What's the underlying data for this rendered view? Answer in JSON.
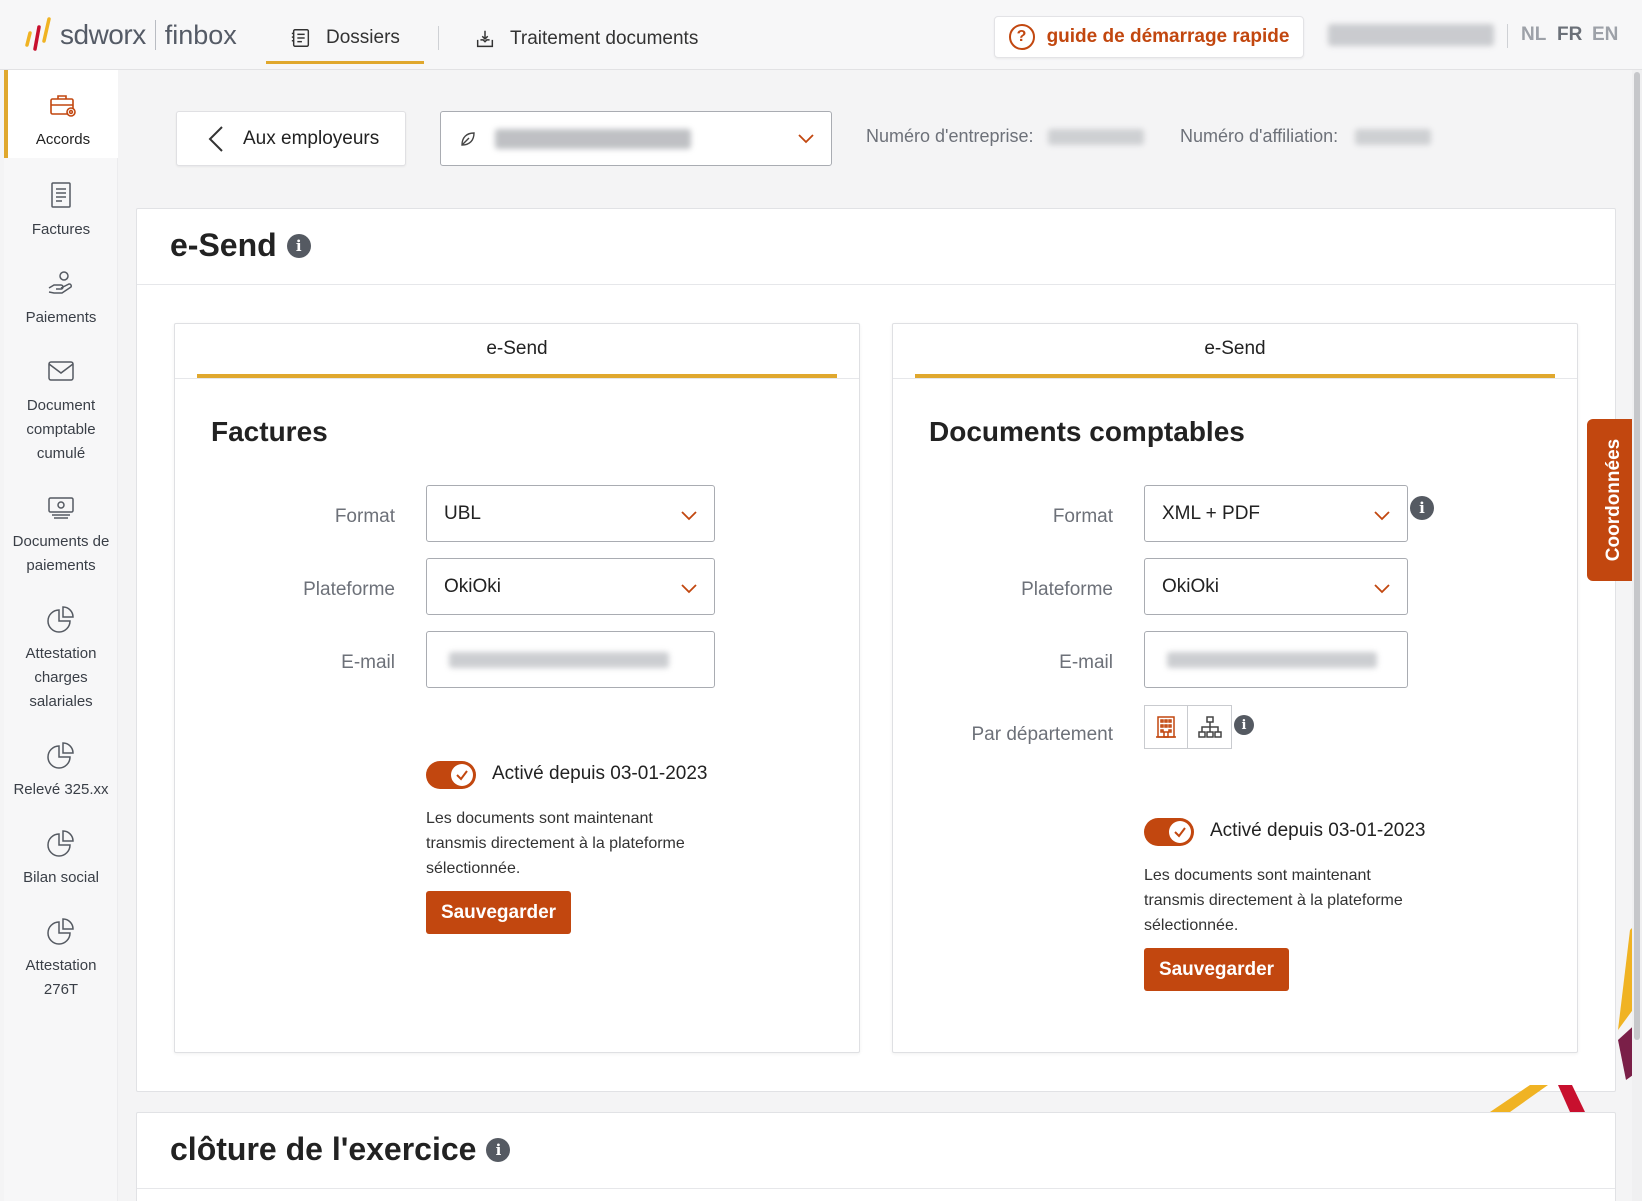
{
  "topbar": {
    "logo_brand": "sdworx",
    "logo_product": "finbox",
    "nav": [
      {
        "label": "Dossiers",
        "icon": "document-list-icon",
        "active": true
      },
      {
        "label": "Traitement documents",
        "icon": "download-tray-icon",
        "active": false
      }
    ],
    "guide_label": "guide de démarrage rapide",
    "languages": [
      {
        "code": "NL",
        "active": false
      },
      {
        "code": "FR",
        "active": true
      },
      {
        "code": "EN",
        "active": false
      }
    ]
  },
  "sidebar": {
    "items": [
      {
        "label": "Accords",
        "icon": "briefcase-gear-icon",
        "active": true
      },
      {
        "label": "Factures",
        "icon": "invoice-icon",
        "active": false
      },
      {
        "label": "Paiements",
        "icon": "hand-coin-icon",
        "active": false
      },
      {
        "label": "Document comptable cumulé",
        "icon": "envelope-icon",
        "active": false
      },
      {
        "label": "Documents de paiements",
        "icon": "banknote-icon",
        "active": false
      },
      {
        "label": "Attestation charges salariales",
        "icon": "pie-chart-icon",
        "active": false
      },
      {
        "label": "Relevé 325.xx",
        "icon": "pie-chart-icon",
        "active": false
      },
      {
        "label": "Bilan social",
        "icon": "pie-chart-icon",
        "active": false
      },
      {
        "label": "Attestation 276T",
        "icon": "pie-chart-icon",
        "active": false
      }
    ]
  },
  "header": {
    "back_label": "Aux employeurs",
    "company_number_label": "Numéro d'entreprise:",
    "affiliation_number_label": "Numéro d'affiliation:"
  },
  "esend": {
    "title": "e-Send",
    "factures": {
      "tab_label": "e-Send",
      "title": "Factures",
      "format_label": "Format",
      "format_value": "UBL",
      "platform_label": "Plateforme",
      "platform_value": "OkiOki",
      "email_label": "E-mail",
      "toggle_label": "Activé depuis 03-01-2023",
      "toggle_on": true,
      "description": "Les documents sont maintenant transmis directement à la plateforme sélectionnée.",
      "save_label": "Sauvegarder"
    },
    "documents": {
      "tab_label": "e-Send",
      "title": "Documents comptables",
      "format_label": "Format",
      "format_value": "XML + PDF",
      "platform_label": "Plateforme",
      "platform_value": "OkiOki",
      "email_label": "E-mail",
      "department_label": "Par département",
      "toggle_label": "Activé depuis 03-01-2023",
      "toggle_on": true,
      "description": "Les documents sont maintenant transmis directement à la plateforme sélectionnée.",
      "save_label": "Sauvegarder"
    }
  },
  "side_tab": {
    "label": "Coordonnées"
  },
  "closing": {
    "title": "clôture de l'exercice"
  },
  "colors": {
    "accent": "#e0a82e",
    "primary": "#c2470f"
  }
}
